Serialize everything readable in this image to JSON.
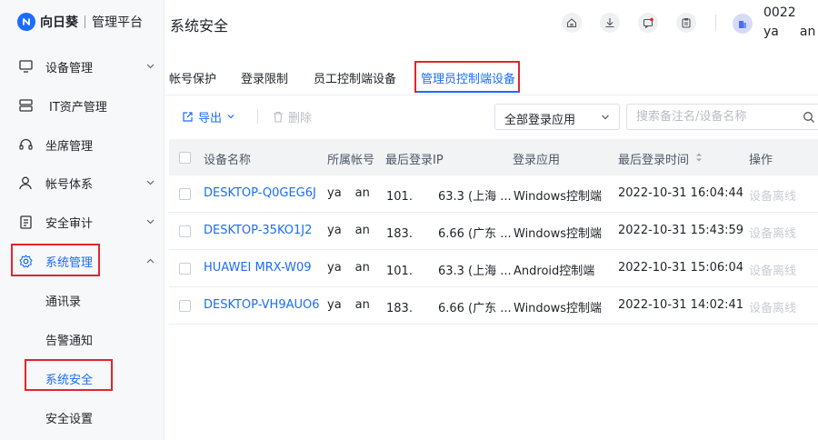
{
  "app": {
    "brand_name": "向日葵",
    "brand_sub": "管理平台"
  },
  "sidebar": {
    "items": [
      {
        "label": "设备管理",
        "icon": "monitor-icon"
      },
      {
        "label": "IT资产管理",
        "icon": "server-icon"
      },
      {
        "label": "坐席管理",
        "icon": "headset-icon"
      },
      {
        "label": "帐号体系",
        "icon": "user-icon"
      },
      {
        "label": "安全审计",
        "icon": "audit-icon"
      },
      {
        "label": "系统管理",
        "icon": "gear-icon"
      }
    ],
    "sub_items": [
      {
        "label": "通讯录"
      },
      {
        "label": "告警通知"
      },
      {
        "label": "系统安全"
      },
      {
        "label": "安全设置"
      }
    ]
  },
  "header": {
    "title": "系统安全",
    "user_id": "0022",
    "user_name_start": "ya",
    "user_name_end": "an"
  },
  "tabs": [
    {
      "label": "帐号保护"
    },
    {
      "label": "登录限制"
    },
    {
      "label": "员工控制端设备"
    },
    {
      "label": "管理员控制端设备",
      "active": true
    }
  ],
  "toolbar": {
    "export_label": "导出",
    "delete_label": "删除",
    "app_filter_value": "全部登录应用",
    "search_placeholder": "搜索备注名/设备名称"
  },
  "table": {
    "columns": [
      "设备名称",
      "所属帐号",
      "最后登录IP",
      "登录应用",
      "最后登录时间",
      "操作"
    ],
    "rows": [
      {
        "device": "DESKTOP-Q0GEG6J",
        "acct_a": "ya",
        "acct_b": "an",
        "ip_a": "101.",
        "ip_b": "63.3 (上海 ...",
        "app": "Windows控制端",
        "time": "2022-10-31 16:04:44",
        "op": "设备离线"
      },
      {
        "device": "DESKTOP-35KO1J2",
        "acct_a": "ya",
        "acct_b": "an",
        "ip_a": "183.",
        "ip_b": "6.66 (广东 ...",
        "app": "Windows控制端",
        "time": "2022-10-31 15:43:59",
        "op": "设备离线"
      },
      {
        "device": "HUAWEI MRX-W09",
        "acct_a": "ya",
        "acct_b": "an",
        "ip_a": "101.",
        "ip_b": "63.3 (上海 ...",
        "app": "Android控制端",
        "time": "2022-10-31 15:06:04",
        "op": "设备离线"
      },
      {
        "device": "DESKTOP-VH9AUO6",
        "acct_a": "ya",
        "acct_b": "an",
        "ip_a": "183.",
        "ip_b": "6.66 (广东 ...",
        "app": "Windows控制端",
        "time": "2022-10-31 14:02:41",
        "op": "设备离线"
      }
    ]
  },
  "colors": {
    "accent": "#1b6cff",
    "highlight": "#e0262f"
  }
}
